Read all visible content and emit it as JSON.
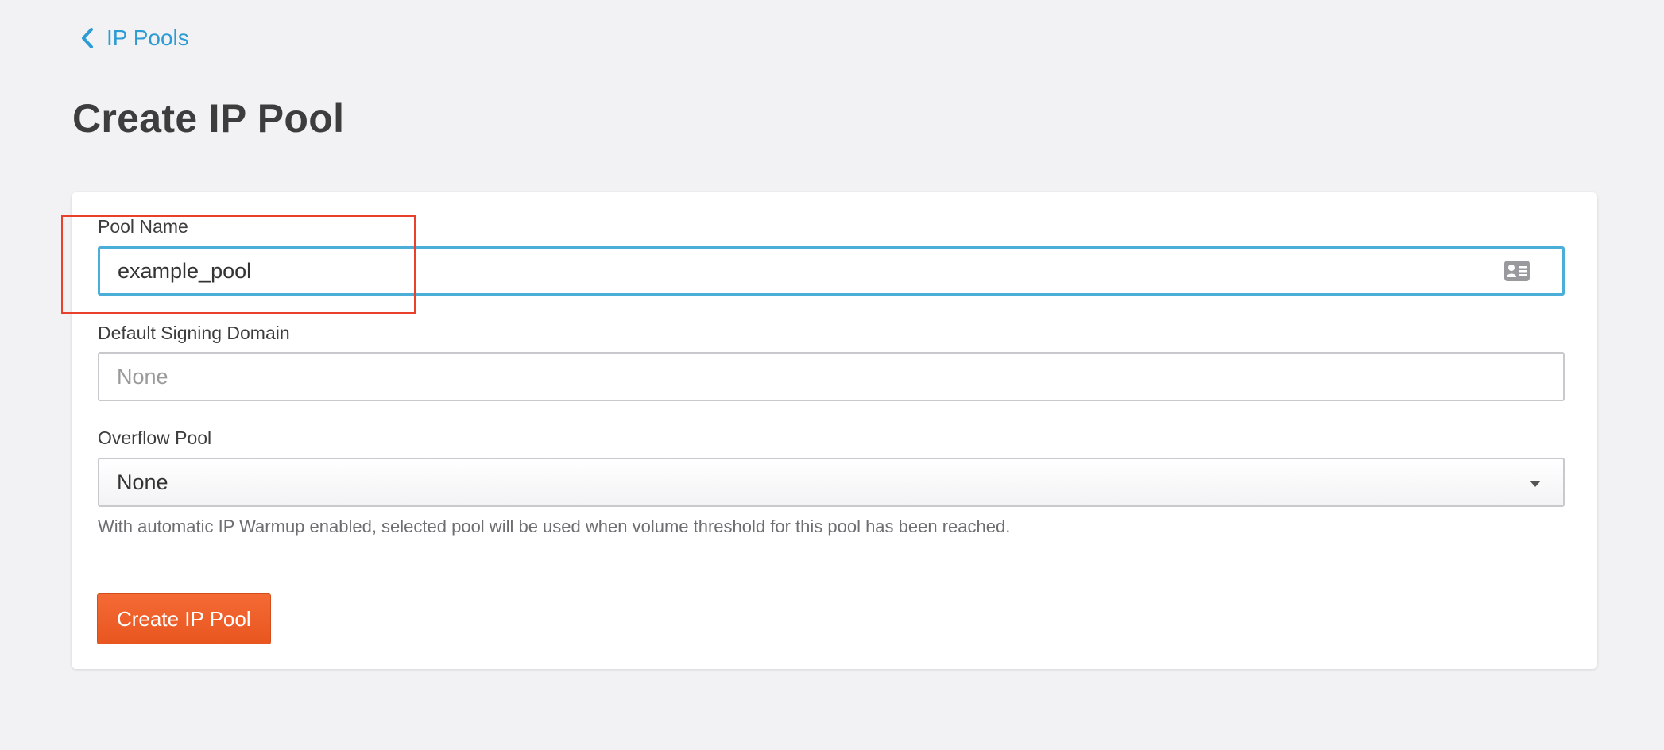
{
  "nav": {
    "back_label": "IP Pools"
  },
  "page": {
    "title": "Create IP Pool"
  },
  "form": {
    "pool_name": {
      "label": "Pool Name",
      "value": "example_pool",
      "icon": "contact-card-icon"
    },
    "signing_domain": {
      "label": "Default Signing Domain",
      "placeholder": "None",
      "value": ""
    },
    "overflow_pool": {
      "label": "Overflow Pool",
      "selected": "None",
      "help": "With automatic IP Warmup enabled, selected pool will be used when volume threshold for this pool has been reached."
    },
    "submit_label": "Create IP Pool"
  },
  "colors": {
    "accent": "#2d9cd4",
    "focus_border": "#4aaed8",
    "primary_button": "#f0612b",
    "highlight": "#e8402a"
  }
}
